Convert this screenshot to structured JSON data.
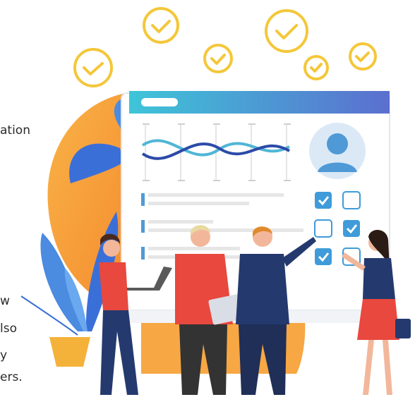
{
  "text_fragments": {
    "line_1": "ation",
    "line_2": "w",
    "line_3": "lso",
    "line_4": "y",
    "line_5": "ers."
  },
  "colors": {
    "check_yellow": "#f4c73a",
    "sun_orange": "#f7a23a",
    "leaf_blue": "#3b6fd8",
    "header_gradient_start": "#3ec5d8",
    "header_gradient_end": "#5b6fcf",
    "wave_teal": "#4fb6d6",
    "wave_navy": "#2c4aa8",
    "avatar_bg": "#dbe9f6",
    "avatar_fg": "#4f9ad6",
    "checkbox_blue": "#3f9bd9",
    "shirt_red": "#e8483e",
    "suit_navy": "#243a6e"
  },
  "icons": {
    "floating_checks": "check-circle-icon",
    "checkbox_checked": "checkbox-checked-icon",
    "checkbox_empty": "checkbox-empty-icon",
    "user_avatar": "user-avatar-icon"
  }
}
